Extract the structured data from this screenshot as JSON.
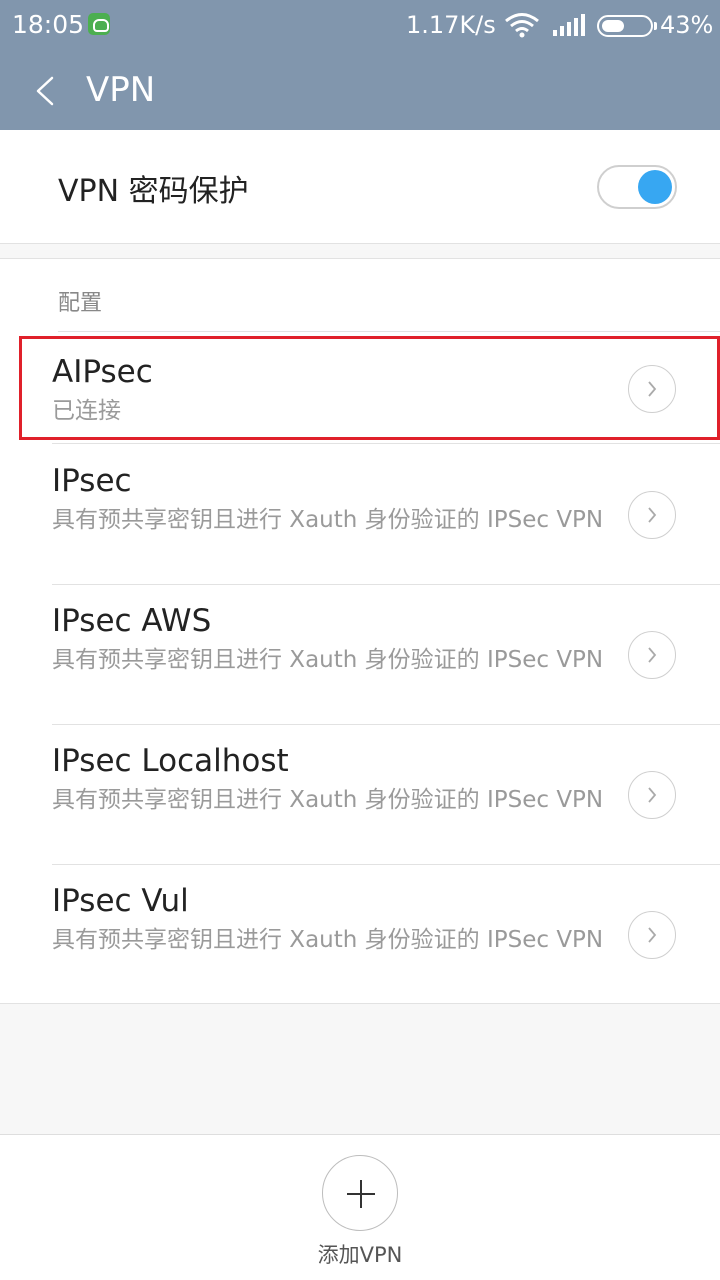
{
  "status_bar": {
    "time": "18:05",
    "speed": "1.17K/s",
    "battery": "43%",
    "battery_level": 0.43,
    "icons": [
      "app-notification-icon",
      "wifi-icon",
      "signal-icon",
      "battery-icon"
    ]
  },
  "app_bar": {
    "title": "VPN"
  },
  "password_protection": {
    "label": "VPN 密码保护",
    "enabled": true,
    "accent": "#37a7f2"
  },
  "config": {
    "header": "配置",
    "items": [
      {
        "name": "AIPsec",
        "subtitle": "已连接"
      },
      {
        "name": "IPsec",
        "subtitle": "具有预共享密钥且进行 Xauth 身份验证的 IPSec VPN"
      },
      {
        "name": "IPsec AWS",
        "subtitle": "具有预共享密钥且进行 Xauth 身份验证的 IPSec VPN"
      },
      {
        "name": "IPsec Localhost",
        "subtitle": "具有预共享密钥且进行 Xauth 身份验证的 IPSec VPN"
      },
      {
        "name": "IPsec Vul",
        "subtitle": "具有预共享密钥且进行 Xauth 身份验证的 IPSec VPN"
      }
    ]
  },
  "bottom": {
    "add_label": "添加VPN"
  },
  "colors": {
    "header_bg": "#8196ad",
    "highlight": "#e0202a"
  }
}
